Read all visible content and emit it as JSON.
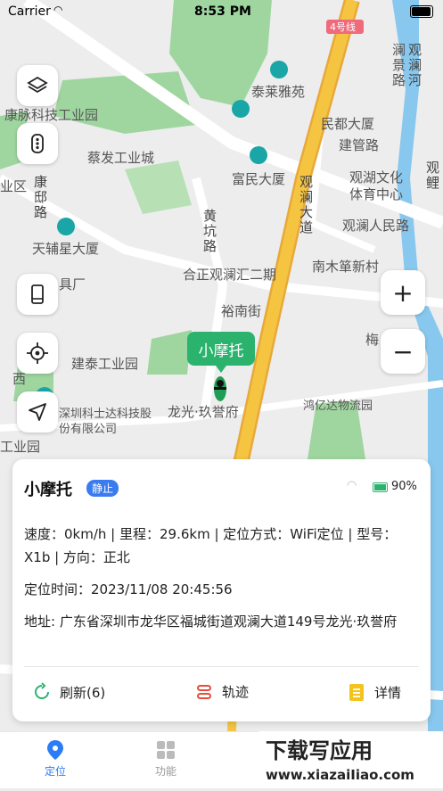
{
  "statusbar": {
    "carrier": "Carrier",
    "time": "8:53 PM"
  },
  "map": {
    "labels": [
      "康脉科技工业园",
      "蔡发工业城",
      "天辅星大厦",
      "泰莱雅苑",
      "富民大厦",
      "民都大厦",
      "建管路",
      "观湖文化体育中心",
      "观澜人民路",
      "南木箪新村",
      "合正观澜汇二期",
      "裕南街",
      "建泰工业园",
      "深圳科士达科技股份有限公司",
      "龙光·玖誉府",
      "鸿亿达物流园",
      "业区",
      "工业园",
      "具厂",
      "澜景路",
      "4号线",
      "观澜人民路",
      "梅",
      "西"
    ],
    "vlabels": [
      "康邸路",
      "观澜大道",
      "黄坑路",
      "观澜河",
      "观鲤"
    ]
  },
  "marker": {
    "label": "小摩托"
  },
  "zoom": {
    "in": "+",
    "out": "−"
  },
  "card": {
    "name": "小摩托",
    "status": "静止",
    "battery": "90%",
    "speed_line": "速度：0km/h | 里程：29.6km | 定位方式：WiFi定位 | 型号：X1b | 方向：正北",
    "time_line": "定位时间：2023/11/08 20:45:56",
    "address_line": "地址: 广东省深圳市龙华区福城街道观澜大道149号龙光·玖誉府",
    "actions": {
      "refresh": "刷新(6)",
      "track": "轨迹",
      "detail": "详情"
    }
  },
  "tabs": {
    "locate": "定位",
    "functions": "功能"
  },
  "watermark": "下载写应用 www.xiazaiIiao.com",
  "colors": {
    "accent": "#2b7cf6",
    "green": "#2bb36e",
    "road": "#f5c542"
  }
}
